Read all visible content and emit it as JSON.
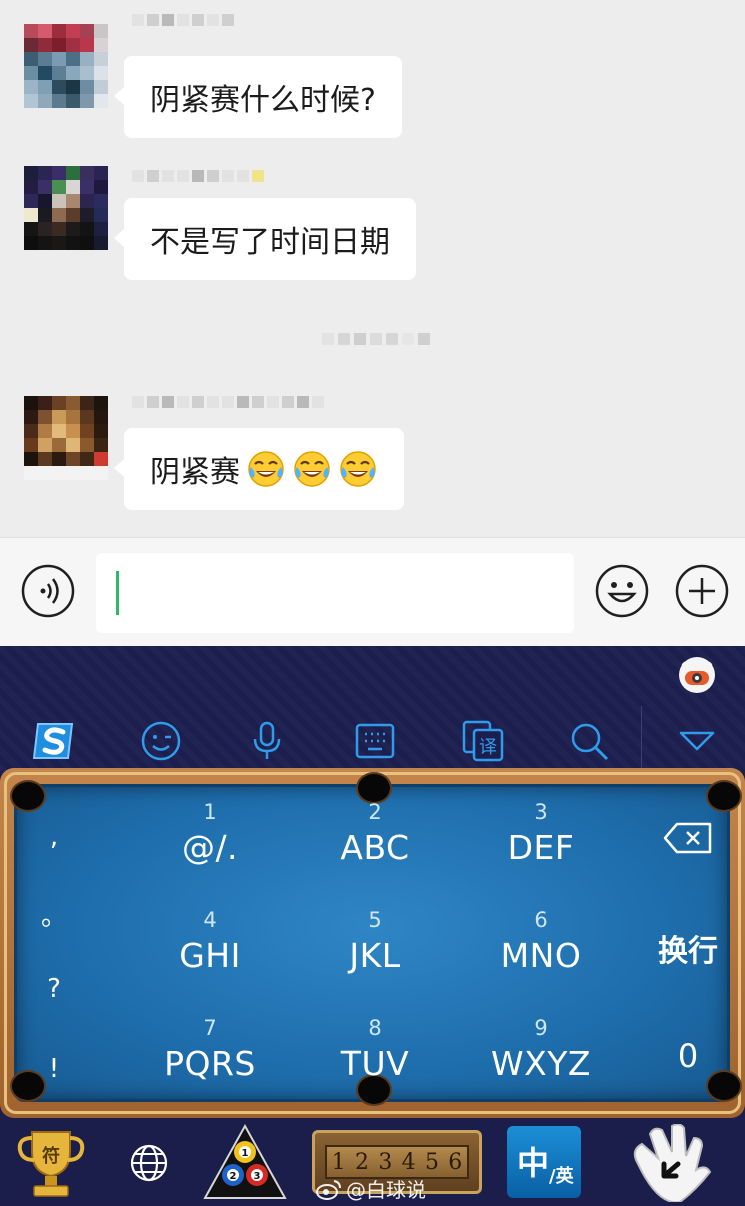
{
  "chat": {
    "messages": [
      {
        "text": "阴紧赛什么时候?"
      },
      {
        "text": "不是写了时间日期"
      },
      {
        "text": "阴紧赛",
        "emoji_count": 3,
        "emoji": "tears-of-joy-icon"
      }
    ]
  },
  "input_bar": {
    "placeholder": "",
    "value": "",
    "accent_color": "#2fb86b"
  },
  "keyboard": {
    "theme": "billiards",
    "toolbar": [
      "sogou-logo-icon",
      "smiley-icon",
      "microphone-icon",
      "keyboard-icon",
      "translate-icon",
      "search-icon",
      "collapse-icon"
    ],
    "translate_glyph": "译",
    "symbols": [
      ",",
      "。",
      "?",
      "!"
    ],
    "keys": [
      {
        "num": "1",
        "letters": "@/."
      },
      {
        "num": "2",
        "letters": "ABC"
      },
      {
        "num": "3",
        "letters": "DEF"
      },
      {
        "num": "4",
        "letters": "GHI"
      },
      {
        "num": "5",
        "letters": "JKL"
      },
      {
        "num": "6",
        "letters": "MNO"
      },
      {
        "num": "7",
        "letters": "PQRS"
      },
      {
        "num": "8",
        "letters": "TUV"
      },
      {
        "num": "9",
        "letters": "WXYZ"
      }
    ],
    "enter_label": "换行",
    "zero_label": "0",
    "bottom": {
      "trophy_glyph": "符",
      "ball_numbers": [
        "1",
        "2",
        "3"
      ],
      "score_digits": [
        "1",
        "2",
        "3",
        "4",
        "5",
        "6"
      ],
      "lang_main": "中",
      "lang_alt": "/英"
    }
  },
  "watermark": "@白球说"
}
